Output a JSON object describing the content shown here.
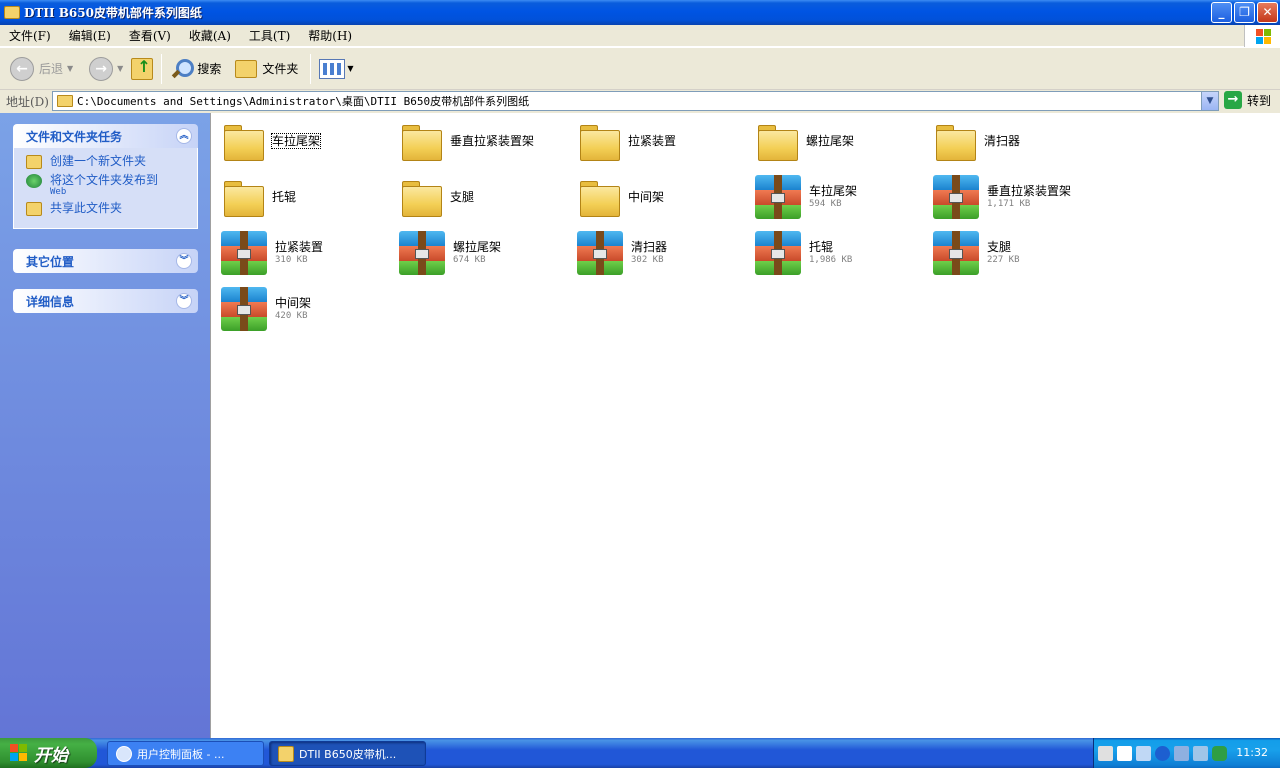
{
  "window": {
    "title": "DTII B650皮带机部件系列图纸"
  },
  "menu": [
    "文件(F)",
    "编辑(E)",
    "查看(V)",
    "收藏(A)",
    "工具(T)",
    "帮助(H)"
  ],
  "toolbar": {
    "back_label": "后退",
    "search_label": "搜索",
    "folders_label": "文件夹"
  },
  "address": {
    "label": "地址(D)",
    "path": "C:\\Documents and Settings\\Administrator\\桌面\\DTII B650皮带机部件系列图纸",
    "go_label": "转到"
  },
  "sidebar": {
    "tasks": {
      "title": "文件和文件夹任务",
      "items": [
        {
          "label": "创建一个新文件夹"
        },
        {
          "label": "将这个文件夹发布到",
          "sub": "Web"
        },
        {
          "label": "共享此文件夹"
        }
      ]
    },
    "other_places": {
      "title": "其它位置"
    },
    "details": {
      "title": "详细信息"
    }
  },
  "files": [
    {
      "name": "车拉尾架",
      "type": "folder",
      "size": ""
    },
    {
      "name": "垂直拉紧装置架",
      "type": "folder",
      "size": ""
    },
    {
      "name": "拉紧装置",
      "type": "folder",
      "size": ""
    },
    {
      "name": "螺拉尾架",
      "type": "folder",
      "size": ""
    },
    {
      "name": "清扫器",
      "type": "folder",
      "size": ""
    },
    {
      "name": "托辊",
      "type": "folder",
      "size": ""
    },
    {
      "name": "支腿",
      "type": "folder",
      "size": ""
    },
    {
      "name": "中间架",
      "type": "folder",
      "size": ""
    },
    {
      "name": "车拉尾架",
      "type": "rar",
      "size": "594 KB"
    },
    {
      "name": "垂直拉紧装置架",
      "type": "rar",
      "size": "1,171 KB"
    },
    {
      "name": "拉紧装置",
      "type": "rar",
      "size": "310 KB"
    },
    {
      "name": "螺拉尾架",
      "type": "rar",
      "size": "674 KB"
    },
    {
      "name": "清扫器",
      "type": "rar",
      "size": "302 KB"
    },
    {
      "name": "托辊",
      "type": "rar",
      "size": "1,986 KB"
    },
    {
      "name": "支腿",
      "type": "rar",
      "size": "227 KB"
    },
    {
      "name": "中间架",
      "type": "rar",
      "size": "420 KB"
    }
  ],
  "taskbar": {
    "start_label": "开始",
    "tasks": [
      "用户控制面板 - ...",
      "DTII B650皮带机..."
    ],
    "clock": "11:32"
  }
}
